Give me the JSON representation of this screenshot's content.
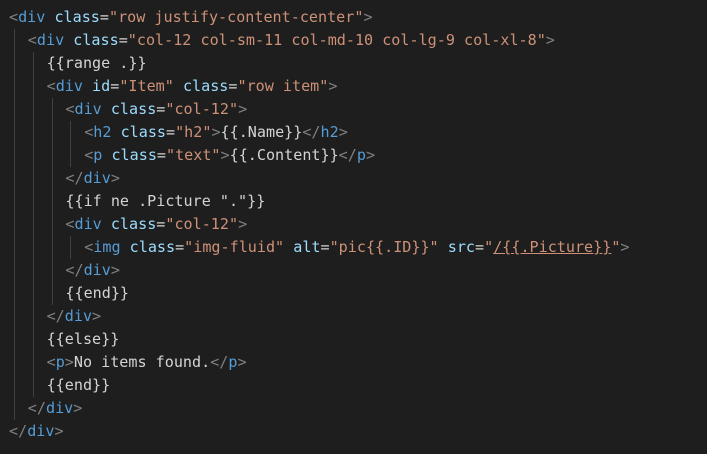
{
  "editor": {
    "language": "html",
    "colors": {
      "background": "#1e1e1e",
      "tag": "#569cd6",
      "bracket": "#808080",
      "attribute": "#9cdcfe",
      "string": "#ce9178",
      "text": "#d4d4d4",
      "indent_guide": "#404040"
    },
    "lines": [
      {
        "indent": 0,
        "tokens": [
          {
            "t": "bracket",
            "v": "<"
          },
          {
            "t": "tag",
            "v": "div"
          },
          {
            "t": "text",
            "v": " "
          },
          {
            "t": "attr",
            "v": "class"
          },
          {
            "t": "text",
            "v": "="
          },
          {
            "t": "str",
            "v": "\"row justify-content-center\""
          },
          {
            "t": "bracket",
            "v": ">"
          }
        ]
      },
      {
        "indent": 1,
        "tokens": [
          {
            "t": "bracket",
            "v": "<"
          },
          {
            "t": "tag",
            "v": "div"
          },
          {
            "t": "text",
            "v": " "
          },
          {
            "t": "attr",
            "v": "class"
          },
          {
            "t": "text",
            "v": "="
          },
          {
            "t": "str",
            "v": "\"col-12 col-sm-11 col-md-10 col-lg-9 col-xl-8\""
          },
          {
            "t": "bracket",
            "v": ">"
          }
        ]
      },
      {
        "indent": 2,
        "tokens": [
          {
            "t": "text",
            "v": "{{range .}}"
          }
        ]
      },
      {
        "indent": 2,
        "tokens": [
          {
            "t": "bracket",
            "v": "<"
          },
          {
            "t": "tag",
            "v": "div"
          },
          {
            "t": "text",
            "v": " "
          },
          {
            "t": "attr",
            "v": "id"
          },
          {
            "t": "text",
            "v": "="
          },
          {
            "t": "str",
            "v": "\"Item\""
          },
          {
            "t": "text",
            "v": " "
          },
          {
            "t": "attr",
            "v": "class"
          },
          {
            "t": "text",
            "v": "="
          },
          {
            "t": "str",
            "v": "\"row item\""
          },
          {
            "t": "bracket",
            "v": ">"
          }
        ]
      },
      {
        "indent": 3,
        "tokens": [
          {
            "t": "bracket",
            "v": "<"
          },
          {
            "t": "tag",
            "v": "div"
          },
          {
            "t": "text",
            "v": " "
          },
          {
            "t": "attr",
            "v": "class"
          },
          {
            "t": "text",
            "v": "="
          },
          {
            "t": "str",
            "v": "\"col-12\""
          },
          {
            "t": "bracket",
            "v": ">"
          }
        ]
      },
      {
        "indent": 4,
        "tokens": [
          {
            "t": "bracket",
            "v": "<"
          },
          {
            "t": "tag",
            "v": "h2"
          },
          {
            "t": "text",
            "v": " "
          },
          {
            "t": "attr",
            "v": "class"
          },
          {
            "t": "text",
            "v": "="
          },
          {
            "t": "str",
            "v": "\"h2\""
          },
          {
            "t": "bracket",
            "v": ">"
          },
          {
            "t": "text",
            "v": "{{.Name}}"
          },
          {
            "t": "bracket",
            "v": "</"
          },
          {
            "t": "tag",
            "v": "h2"
          },
          {
            "t": "bracket",
            "v": ">"
          }
        ]
      },
      {
        "indent": 4,
        "tokens": [
          {
            "t": "bracket",
            "v": "<"
          },
          {
            "t": "tag",
            "v": "p"
          },
          {
            "t": "text",
            "v": " "
          },
          {
            "t": "attr",
            "v": "class"
          },
          {
            "t": "text",
            "v": "="
          },
          {
            "t": "str",
            "v": "\"text\""
          },
          {
            "t": "bracket",
            "v": ">"
          },
          {
            "t": "text",
            "v": "{{.Content}}"
          },
          {
            "t": "bracket",
            "v": "</"
          },
          {
            "t": "tag",
            "v": "p"
          },
          {
            "t": "bracket",
            "v": ">"
          }
        ]
      },
      {
        "indent": 3,
        "tokens": [
          {
            "t": "bracket",
            "v": "</"
          },
          {
            "t": "tag",
            "v": "div"
          },
          {
            "t": "bracket",
            "v": ">"
          }
        ]
      },
      {
        "indent": 3,
        "tokens": [
          {
            "t": "text",
            "v": "{{if ne .Picture \".\"}}"
          }
        ]
      },
      {
        "indent": 3,
        "tokens": [
          {
            "t": "bracket",
            "v": "<"
          },
          {
            "t": "tag",
            "v": "div"
          },
          {
            "t": "text",
            "v": " "
          },
          {
            "t": "attr",
            "v": "class"
          },
          {
            "t": "text",
            "v": "="
          },
          {
            "t": "str",
            "v": "\"col-12\""
          },
          {
            "t": "bracket",
            "v": ">"
          }
        ]
      },
      {
        "indent": 4,
        "tokens": [
          {
            "t": "bracket",
            "v": "<"
          },
          {
            "t": "tag",
            "v": "img"
          },
          {
            "t": "text",
            "v": " "
          },
          {
            "t": "attr",
            "v": "class"
          },
          {
            "t": "text",
            "v": "="
          },
          {
            "t": "str",
            "v": "\"img-fluid\""
          },
          {
            "t": "text",
            "v": " "
          },
          {
            "t": "attr",
            "v": "alt"
          },
          {
            "t": "text",
            "v": "="
          },
          {
            "t": "str",
            "v": "\"pic{{.ID}}\""
          },
          {
            "t": "text",
            "v": " "
          },
          {
            "t": "attr",
            "v": "src"
          },
          {
            "t": "text",
            "v": "="
          },
          {
            "t": "str",
            "v": "\""
          },
          {
            "t": "link",
            "v": "/{{.Picture}}"
          },
          {
            "t": "str",
            "v": "\""
          },
          {
            "t": "bracket",
            "v": ">"
          }
        ]
      },
      {
        "indent": 3,
        "tokens": [
          {
            "t": "bracket",
            "v": "</"
          },
          {
            "t": "tag",
            "v": "div"
          },
          {
            "t": "bracket",
            "v": ">"
          }
        ]
      },
      {
        "indent": 3,
        "tokens": [
          {
            "t": "text",
            "v": "{{end}}"
          }
        ]
      },
      {
        "indent": 2,
        "tokens": [
          {
            "t": "bracket",
            "v": "</"
          },
          {
            "t": "tag",
            "v": "div"
          },
          {
            "t": "bracket",
            "v": ">"
          }
        ]
      },
      {
        "indent": 2,
        "tokens": [
          {
            "t": "text",
            "v": "{{else}}"
          }
        ]
      },
      {
        "indent": 2,
        "tokens": [
          {
            "t": "bracket",
            "v": "<"
          },
          {
            "t": "tag",
            "v": "p"
          },
          {
            "t": "bracket",
            "v": ">"
          },
          {
            "t": "text",
            "v": "No items found."
          },
          {
            "t": "bracket",
            "v": "</"
          },
          {
            "t": "tag",
            "v": "p"
          },
          {
            "t": "bracket",
            "v": ">"
          }
        ]
      },
      {
        "indent": 2,
        "tokens": [
          {
            "t": "text",
            "v": "{{end}}"
          }
        ]
      },
      {
        "indent": 1,
        "tokens": [
          {
            "t": "bracket",
            "v": "</"
          },
          {
            "t": "tag",
            "v": "div"
          },
          {
            "t": "bracket",
            "v": ">"
          }
        ]
      },
      {
        "indent": 0,
        "tokens": [
          {
            "t": "bracket",
            "v": "</"
          },
          {
            "t": "tag",
            "v": "div"
          },
          {
            "t": "bracket",
            "v": ">"
          }
        ]
      }
    ]
  }
}
